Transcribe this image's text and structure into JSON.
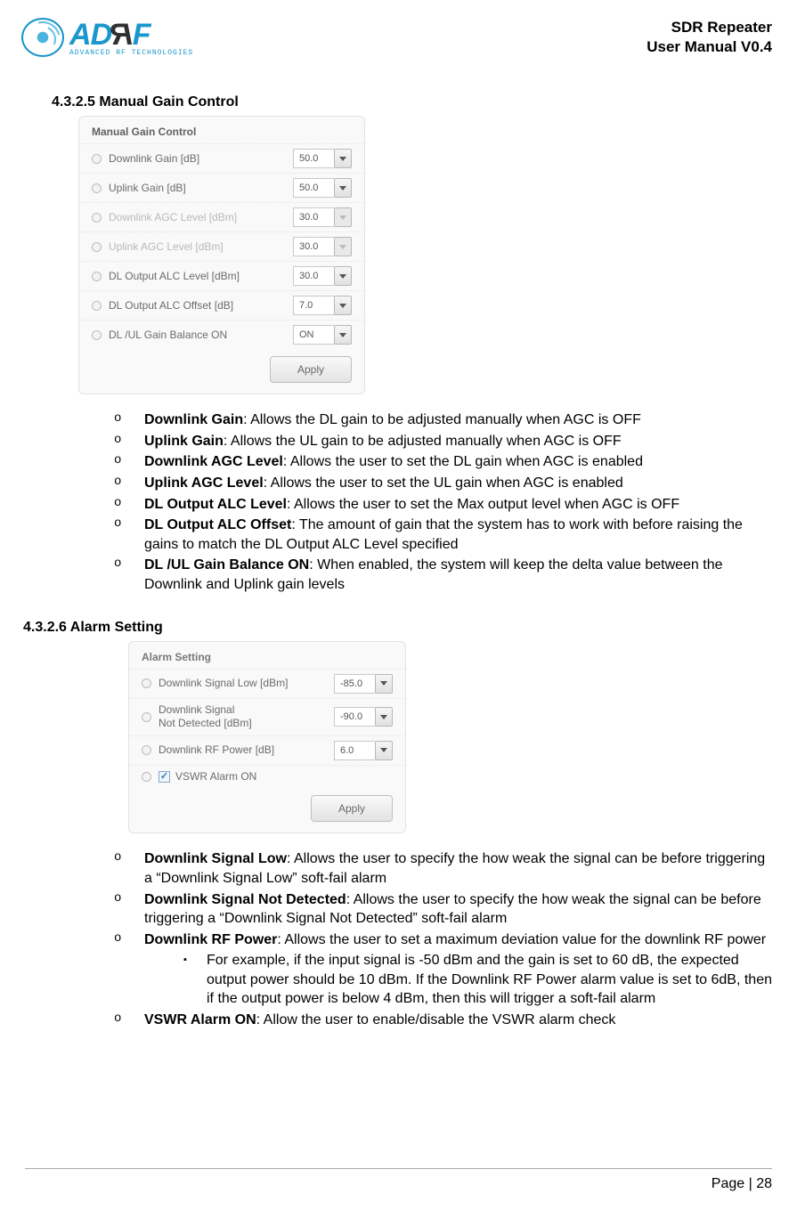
{
  "header": {
    "logo_brand": "ADRF",
    "logo_sub": "ADVANCED RF TECHNOLOGIES",
    "title_line1": "SDR Repeater",
    "title_line2": "User Manual V0.4"
  },
  "section1": {
    "heading": "4.3.2.5 Manual Gain Control",
    "panel_title": "Manual Gain Control",
    "rows": [
      {
        "label": "Downlink Gain [dB]",
        "value": "50.0",
        "disabled": false
      },
      {
        "label": "Uplink Gain [dB]",
        "value": "50.0",
        "disabled": false
      },
      {
        "label": "Downlink AGC Level [dBm]",
        "value": "30.0",
        "disabled": true
      },
      {
        "label": "Uplink AGC Level [dBm]",
        "value": "30.0",
        "disabled": true
      },
      {
        "label": "DL Output ALC Level [dBm]",
        "value": "30.0",
        "disabled": false
      },
      {
        "label": "DL Output ALC Offset [dB]",
        "value": "7.0",
        "disabled": false
      },
      {
        "label": "DL /UL Gain Balance ON",
        "value": "ON",
        "disabled": false
      }
    ],
    "apply": "Apply",
    "bullets": [
      {
        "term": "Downlink Gain",
        "desc": ": Allows the DL gain to be adjusted manually when AGC is OFF"
      },
      {
        "term": "Uplink Gain",
        "desc": ": Allows the UL gain to be adjusted manually when AGC is OFF"
      },
      {
        "term": "Downlink AGC Level",
        "desc": ": Allows the user to set the DL gain when AGC is enabled"
      },
      {
        "term": "Uplink AGC Level",
        "desc": ": Allows the user to set the UL gain when AGC is enabled"
      },
      {
        "term": "DL Output ALC Level",
        "desc": ": Allows the user to set the Max output level when AGC is OFF"
      },
      {
        "term": "DL Output ALC Offset",
        "desc": ": The amount of gain that the system has to work with before raising the gains to match the DL Output ALC Level specified"
      },
      {
        "term": "DL /UL Gain Balance ON",
        "desc": ": When enabled, the system will keep the delta value between the Downlink and Uplink gain levels"
      }
    ]
  },
  "section2": {
    "heading": "4.3.2.6 Alarm Setting",
    "panel_title": "Alarm Setting",
    "rows": [
      {
        "label": "Downlink Signal Low [dBm]",
        "value": "-85.0"
      },
      {
        "label": "Downlink Signal\nNot Detected [dBm]",
        "value": "-90.0"
      },
      {
        "label": "Downlink RF Power [dB]",
        "value": "6.0"
      }
    ],
    "vswr_label": "VSWR Alarm ON",
    "apply": "Apply",
    "bullets": [
      {
        "term": "Downlink Signal Low",
        "desc": ": Allows the user to specify the how weak the signal can be before triggering a “Downlink Signal Low” soft-fail alarm"
      },
      {
        "term": "Downlink Signal Not Detected",
        "desc": ": Allows the user to specify the how weak the signal can be before triggering a “Downlink Signal Not Detected” soft-fail alarm"
      },
      {
        "term": "Downlink RF Power",
        "desc": ": Allows the user to set a maximum deviation value for the downlink RF power",
        "sub": "For example, if the input signal is -50 dBm and the gain is set to 60 dB, the expected output power should be 10 dBm.   If the Downlink RF Power alarm value is set to 6dB, then if the output power is below 4 dBm, then this will trigger a soft-fail alarm"
      },
      {
        "term": "VSWR Alarm ON",
        "desc": ": Allow the user to enable/disable the VSWR alarm check"
      }
    ]
  },
  "page": "Page | 28"
}
